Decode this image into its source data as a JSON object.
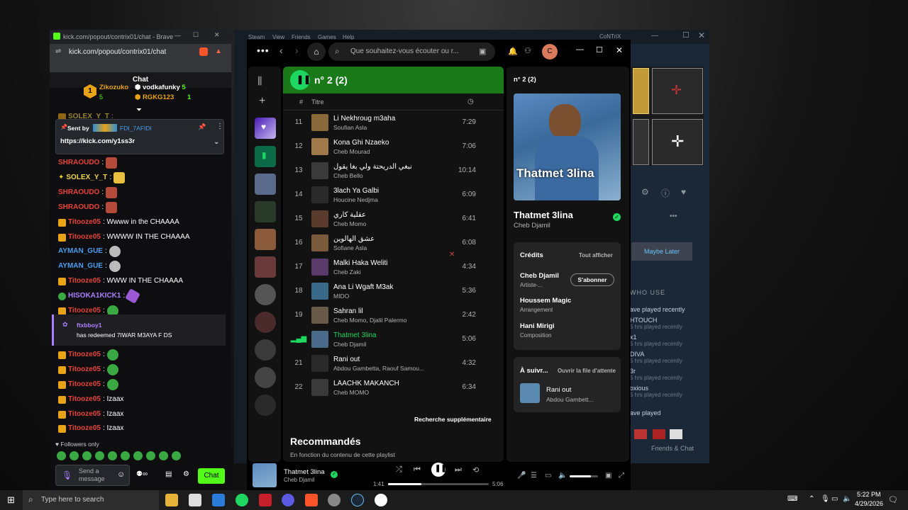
{
  "brave": {
    "tab_title": "kick.com/popout/contrix01/chat - Brave",
    "url": "kick.com/popout/contrix01/chat",
    "chat_header": "Chat",
    "leaderboard": [
      {
        "rank": "1",
        "name": "Zikozuko",
        "count": "5"
      },
      {
        "name": "vodkafunky",
        "count": "5"
      },
      {
        "name": "RGKG123",
        "count": "1"
      }
    ],
    "pinned": {
      "sent_by": "Sent by",
      "user": "FDI_7AFIDI",
      "link": "https://kick.com/y1ss3r"
    },
    "messages": [
      {
        "user": "SOLEX_Y_T",
        "text": ":"
      },
      {
        "user": "SHRAOUDO",
        "text": ":"
      },
      {
        "user": "SOLEX_Y_T",
        "text": ":"
      },
      {
        "user": "SHRAOUDO",
        "text": ":"
      },
      {
        "user": "SHRAOUDO",
        "text": ":"
      },
      {
        "user": "Titooze05",
        "text": ": Wwww in the CHAAAA"
      },
      {
        "user": "Titooze05",
        "text": ": WWWW IN THE CHAAAA"
      },
      {
        "user": "AYMAN_GUE",
        "text": ":"
      },
      {
        "user": "AYMAN_GUE",
        "text": ":"
      },
      {
        "user": "Titooze05",
        "text": ": WWW IN THE CHAAAA"
      },
      {
        "user": "HISOKA1KICK1",
        "text": ":"
      },
      {
        "user": "Titooze05",
        "text": ":"
      }
    ],
    "redeem": {
      "user": "ftxbboy1",
      "text": "has redeemed 7IWAR M3AYA F DS"
    },
    "messages2": [
      {
        "user": "Titooze05",
        "text": ":"
      },
      {
        "user": "Titooze05",
        "text": ":"
      },
      {
        "user": "Titooze05",
        "text": ":"
      },
      {
        "user": "Titooze05",
        "text": ": Izaax"
      },
      {
        "user": "Titooze05",
        "text": ": Izaax"
      },
      {
        "user": "Titooze05",
        "text": ": Izaax"
      }
    ],
    "followers_only": "Followers only",
    "send_placeholder": "Send a message",
    "chat_button": "Chat"
  },
  "steam": {
    "menu": [
      "Steam",
      "View",
      "Friends",
      "Games",
      "Help"
    ],
    "user": "CoNTriX",
    "maybe_later": "Maybe Later",
    "who_use": "WHO USE",
    "played_recently": "ave played recently",
    "friends": [
      {
        "name": "HTOUCH",
        "status": "5 hrs played recently"
      },
      {
        "name": "x1",
        "status": "5 hrs played recently"
      },
      {
        "name": "DIVA",
        "status": "5 hrs played recently"
      },
      {
        "name": "3r",
        "status": "5 hrs played recently"
      },
      {
        "name": "oxious",
        "status": "5 hrs played recently"
      }
    ],
    "have_played": "ave played",
    "friends_chat": "Friends & Chat"
  },
  "spotify": {
    "search_placeholder": "Que souhaitez-vous écouter ou r...",
    "avatar_letter": "C",
    "playlist_title": "n° 2 (2)",
    "col_title": "Titre",
    "col_hash": "#",
    "tracks": [
      {
        "n": "11",
        "title": "Li Nekhroug m3aha",
        "artist": "Soufian Asla",
        "dur": "7:29",
        "color": "#8a6a3a"
      },
      {
        "n": "12",
        "title": "Kona Ghi Nzaeko",
        "artist": "Cheb Mourad",
        "dur": "7:06",
        "color": "#a07a4a"
      },
      {
        "n": "13",
        "title": "نبغي الدريحتة ولي بغا يقول",
        "artist": "Cheb Bello",
        "dur": "10:14",
        "color": "#3a3a3a"
      },
      {
        "n": "14",
        "title": "3lach Ya Galbi",
        "artist": "Houcine Nedjma",
        "dur": "6:09",
        "color": "#2a2a2a"
      },
      {
        "n": "15",
        "title": "عقلية كاري",
        "artist": "Cheb Momo",
        "dur": "6:41",
        "color": "#5a3a2a"
      },
      {
        "n": "16",
        "title": "عشق الهالوين",
        "artist": "Sofiane Asla",
        "dur": "6:08",
        "color": "#7a5a3a"
      },
      {
        "n": "17",
        "title": "Malki Haka Weliti",
        "artist": "Cheb Zaki",
        "dur": "4:34",
        "color": "#5a3a6a"
      },
      {
        "n": "18",
        "title": "Ana Li Wgaft M3ak",
        "artist": "MIDO",
        "dur": "5:36",
        "color": "#3a6a8a"
      },
      {
        "n": "19",
        "title": "Sahran lil",
        "artist": "Cheb Momo, Djalil Palermo",
        "dur": "2:42",
        "color": "#6a5a4a"
      },
      {
        "n": "",
        "title": "Thatmet 3lina",
        "artist": "Cheb Djamil",
        "dur": "5:06",
        "color": "#4a6a8a",
        "playing": true
      },
      {
        "n": "21",
        "title": "Rani out",
        "artist": "Abdou Gambetta, Raouf Samou...",
        "dur": "4:32",
        "color": "#2a2a2a"
      },
      {
        "n": "22",
        "title": "LÂACHK MAKANCH",
        "artist": "Cheb MOMO",
        "dur": "6:34",
        "color": "#3a3a3a"
      }
    ],
    "more_search": "Recherche supplémentaire",
    "recommended": "Recommandés",
    "recommended_sub": "En fonction du contenu de cette playlist",
    "np_panel_title": "n° 2 (2)",
    "cover_text": "Thatmet 3lina",
    "np_title": "Thatmet 3lina",
    "np_artist": "Cheb Djamil",
    "credits_title": "Crédits",
    "show_all": "Tout afficher",
    "credits": [
      {
        "name": "Cheb Djamil",
        "role": "Artiste-..."
      },
      {
        "name": "Houssem Magic",
        "role": "Arrangement"
      },
      {
        "name": "Hani Mirigi",
        "role": "Composition"
      }
    ],
    "follow": "S'abonner",
    "next_title": "À suivr...",
    "open_queue": "Ouvrir la file d'attente",
    "next_track": {
      "title": "Rani out",
      "artist": "Abdou Gambett..."
    },
    "player": {
      "title": "Thatmet 3lina",
      "artist": "Cheb Djamil",
      "elapsed": "1:41",
      "total": "5:06",
      "progress": 0.33,
      "volume": 0.75
    }
  },
  "taskbar": {
    "search_placeholder": "Type here to search",
    "time": "5:22 PM",
    "date": "4/29/2026"
  }
}
